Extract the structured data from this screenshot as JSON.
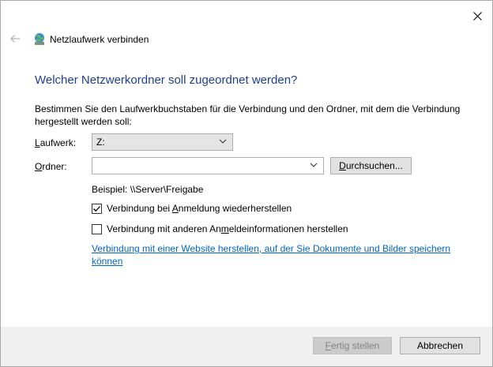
{
  "title": "Netzlaufwerk verbinden",
  "heading": "Welcher Netzwerkordner soll zugeordnet werden?",
  "description": "Bestimmen Sie den Laufwerkbuchstaben für die Verbindung und den Ordner, mit dem die Verbindung hergestellt werden soll:",
  "drive": {
    "label": "Laufwerk:",
    "value": "Z:"
  },
  "folder": {
    "label": "Ordner:",
    "value": "",
    "browse_label": "Durchsuchen..."
  },
  "example": "Beispiel: \\\\Server\\Freigabe",
  "options": [
    {
      "label": "Verbindung bei Anmeldung wiederherstellen",
      "checked": true
    },
    {
      "label": "Verbindung mit anderen Anmeldeinformationen herstellen",
      "checked": false
    }
  ],
  "link": "Verbindung mit einer Website herstellen, auf der Sie Dokumente und Bilder speichern können",
  "footer": {
    "finish_label": "Fertig stellen",
    "cancel_label": "Abbrechen"
  },
  "icons": [
    "close-icon",
    "back-arrow-icon",
    "network-drive-icon",
    "chevron-down-icon",
    "checkmark-icon"
  ]
}
